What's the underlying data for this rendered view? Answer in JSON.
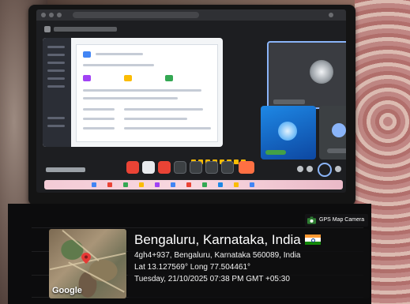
{
  "overlay": {
    "title": "Bengaluru, Karnataka, India",
    "address": "4gh4+937, Bengaluru, Karnataka 560089, India",
    "coordinates": "Lat 13.127569° Long 77.504461°",
    "datetime": "Tuesday, 21/10/2025 07:38 PM GMT +05:30",
    "map_label": "Google",
    "badge_label": "GPS Map Camera",
    "flag_icon": "india-flag-icon",
    "pin_icon": "map-pin-icon",
    "colors": {
      "pin": "#e53935",
      "saffron": "#ff9933",
      "green": "#138808",
      "meet_blue": "#8ab4f8",
      "end_call": "#ea4335"
    }
  }
}
